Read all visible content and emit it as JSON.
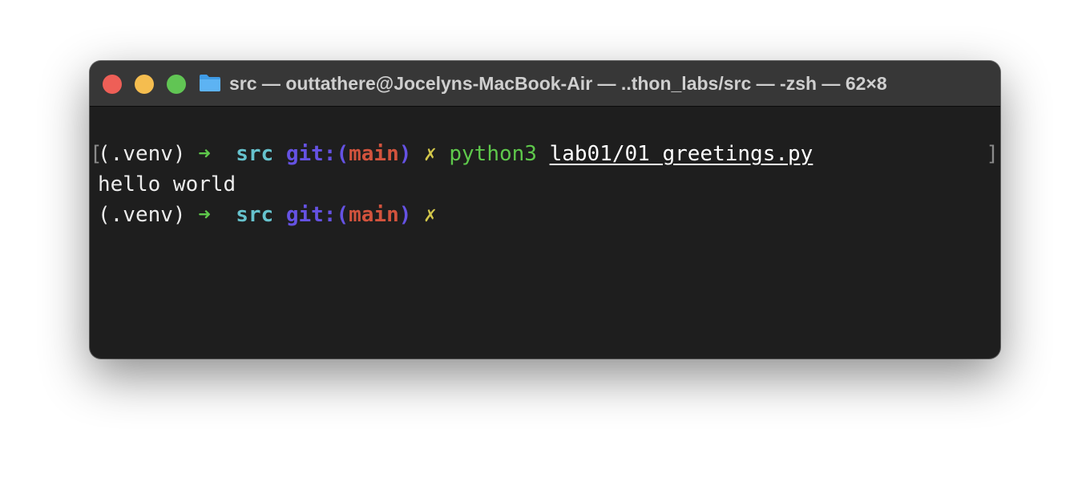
{
  "window": {
    "title": "src — outtathere@Jocelyns-MacBook-Air — ..thon_labs/src — -zsh — 62×8",
    "folder_icon": "folder-icon",
    "colors": {
      "close": "#ee5f57",
      "minimize": "#f5bd4f",
      "zoom": "#61c554",
      "background": "#1e1e1e",
      "titlebar": "#373737"
    }
  },
  "terminal": {
    "lines": [
      {
        "venv": "(.venv)",
        "arrow": "➜",
        "dir": "src",
        "git_open": "git:(",
        "branch": "main",
        "git_close": ")",
        "dirty": "✗",
        "command": "python3",
        "argument": "lab01/01_greetings.py"
      },
      {
        "output": "hello world"
      },
      {
        "venv": "(.venv)",
        "arrow": "➜",
        "dir": "src",
        "git_open": "git:(",
        "branch": "main",
        "git_close": ")",
        "dirty": "✗"
      }
    ],
    "mark_left": "[",
    "mark_right": "]",
    "colors": {
      "arrow": "#5ec84b",
      "dir": "#66c2cd",
      "git": "#6552e3",
      "branch": "#d2533d",
      "dirty": "#d2c64a",
      "command": "#5ec84b"
    }
  }
}
